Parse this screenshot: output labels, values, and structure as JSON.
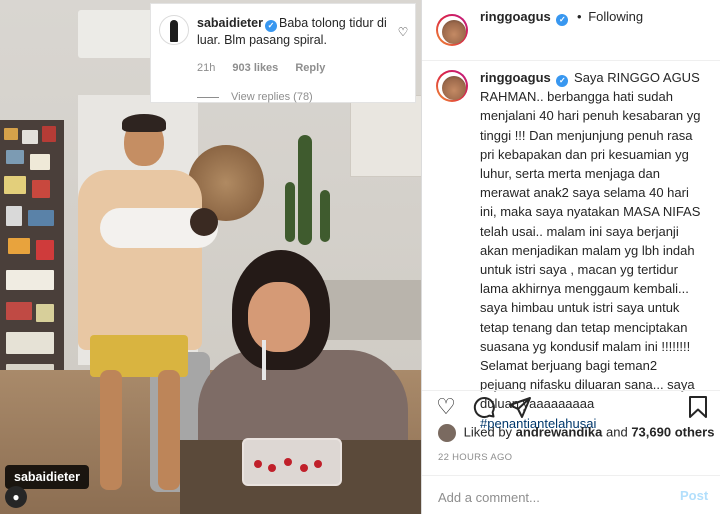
{
  "overlay": {
    "user": "sabaidieter",
    "comment": "Baba tolong tidur di luar. Blm pasang spiral.",
    "age": "21h",
    "likes": "903 likes",
    "reply": "Reply",
    "view_replies": "View replies (78)"
  },
  "photo_tag": {
    "user": "sabaidieter"
  },
  "post": {
    "author": "ringgoagus",
    "follow_state": "Following",
    "caption_user": "ringgoagus",
    "caption_text": "Saya RINGGO AGUS RAHMAN.. berbangga hati sudah menjalani 40 hari penuh kesabaran yg tinggi !!! Dan menjunjung penuh rasa pri kebapakan dan pri kesuamian yg luhur, serta merta menjaga dan merawat anak2 saya selama 40 hari ini, maka saya nyatakan MASA NIFAS telah usai.. malam ini saya berjanji akan menjadikan malam yg lbh indah untuk istri saya , macan yg tertidur lama akhirnya menggaum kembali... saya himbau untuk istri saya untuk tetap tenang dan tetap menciptakan suasana yg kondusif malam ini !!!!!!!! Selamat berjuang bagi teman2 pejuang nifasku diluaran sana... saya duluan yaaaaaaaaa",
    "hashtag": "#penantiantelahusai",
    "liked_by_prefix": "Liked by",
    "liked_by_user": "andrewandika",
    "liked_by_and": "and",
    "liked_by_others": "73,690 others",
    "time_ago": "22 HOURS AGO",
    "comment_placeholder": "Add a comment...",
    "post_label": "Post"
  },
  "icons": {
    "verified": "verified-badge-icon",
    "heart": "heart-icon",
    "comment": "comment-icon",
    "share": "share-icon",
    "bookmark": "bookmark-icon"
  },
  "colors": {
    "verified": "#3897f0",
    "hashtag": "#00376b",
    "post_disabled": "#b2dffc",
    "muted": "#8e8e8e"
  }
}
